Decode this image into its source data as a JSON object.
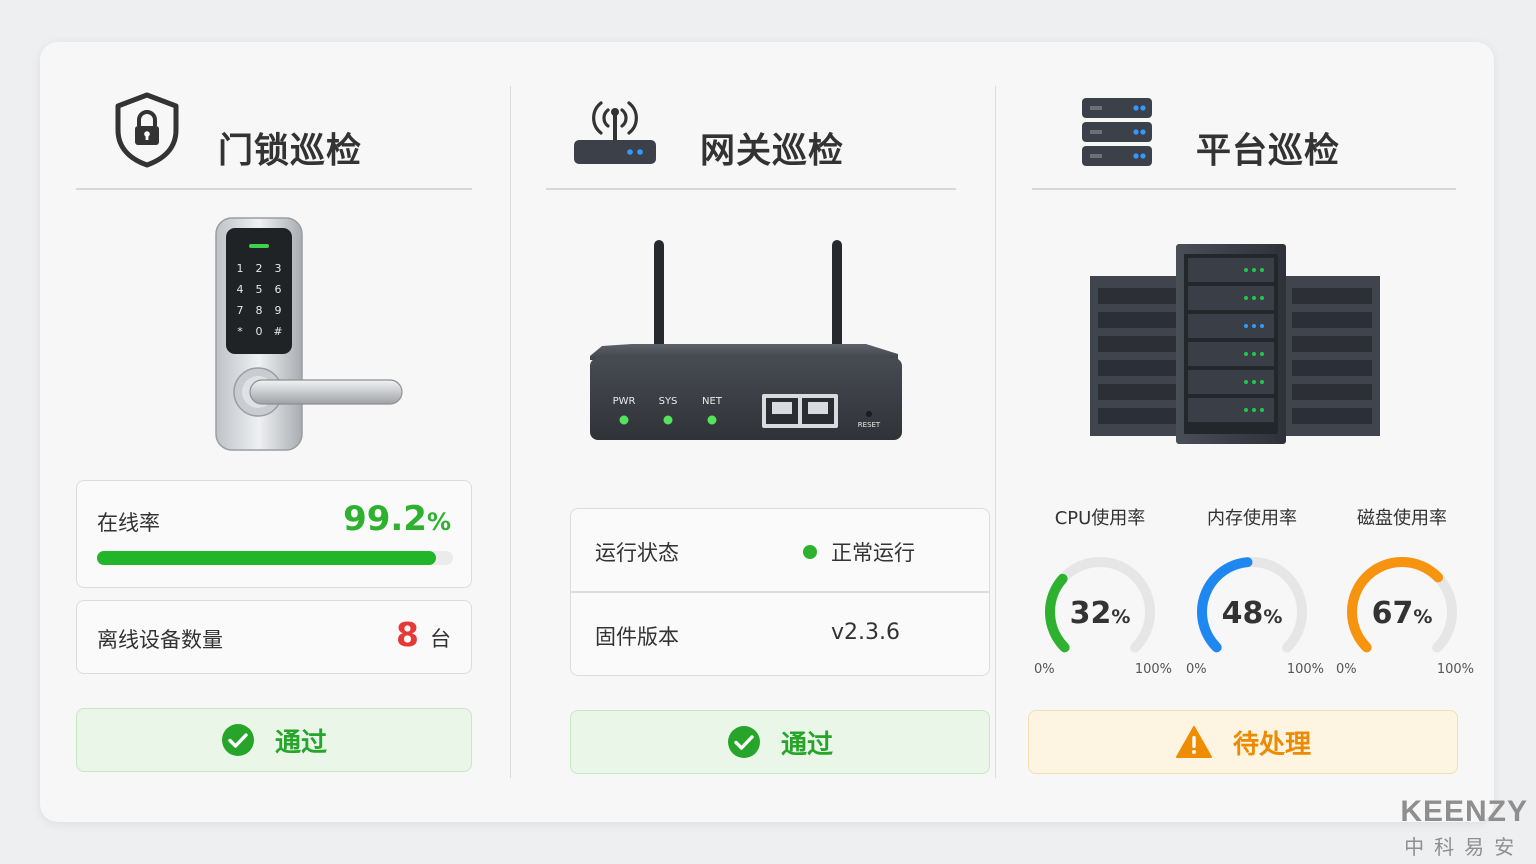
{
  "columns": {
    "lock": {
      "title": "门锁巡检",
      "icon": "shield-lock-icon",
      "keypad": [
        "1",
        "2",
        "3",
        "4",
        "5",
        "6",
        "7",
        "8",
        "9",
        "*",
        "0",
        "#"
      ],
      "online_label": "在线率",
      "online_value": "99.2",
      "online_unit": "%",
      "online_fraction": 0.992,
      "offline_label": "离线设备数量",
      "offline_count": "8",
      "offline_unit": "台",
      "status_label": "通过",
      "status_icon": "check-circle-icon"
    },
    "gateway": {
      "title": "网关巡检",
      "icon": "wifi-router-icon",
      "leds": [
        "PWR",
        "SYS",
        "NET"
      ],
      "reset_label": "RESET",
      "run_label": "运行状态",
      "run_value": "正常运行",
      "fw_label": "固件版本",
      "fw_value": "v2.3.6",
      "status_label": "通过",
      "status_icon": "check-circle-icon"
    },
    "platform": {
      "title": "平台巡检",
      "icon": "server-stack-icon",
      "gauges": [
        {
          "label": "CPU使用率",
          "value": "32",
          "fraction": 0.32,
          "color": "#2db12f"
        },
        {
          "label": "内存使用率",
          "value": "48",
          "fraction": 0.48,
          "color": "#1e88f0"
        },
        {
          "label": "磁盘使用率",
          "value": "67",
          "fraction": 0.67,
          "color": "#f7940f"
        }
      ],
      "gauge_unit": "%",
      "gauge_min": "0%",
      "gauge_max": "100%",
      "status_label": "待处理",
      "status_icon": "warning-triangle-icon"
    }
  },
  "colors": {
    "pass": "#27a52b",
    "warn": "#ee8a00",
    "alert_red": "#e53935",
    "track": "#ebebeb"
  },
  "brand": {
    "name": "KEENZY",
    "cn_name": "中科易安"
  }
}
